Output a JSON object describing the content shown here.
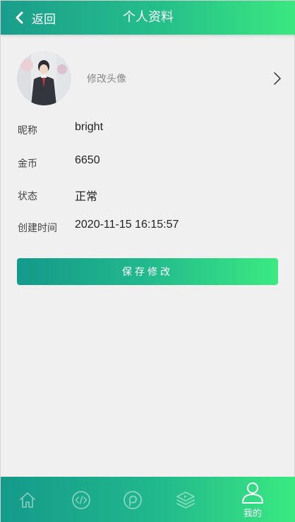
{
  "header": {
    "back_label": "返回",
    "title": "个人资料"
  },
  "avatar": {
    "label": "修改头像"
  },
  "profile": {
    "nickname": {
      "label": "昵称",
      "value": "bright"
    },
    "coins": {
      "label": "金币",
      "value": "6650"
    },
    "status": {
      "label": "状态",
      "value": "正常"
    },
    "created": {
      "label": "创建时间",
      "value": "2020-11-15 16:15:57"
    }
  },
  "save_button": {
    "label": "保存修改"
  },
  "bottom_nav": {
    "items": [
      {
        "icon": "home-icon",
        "active": false
      },
      {
        "icon": "code-icon",
        "active": false
      },
      {
        "icon": "discover-icon",
        "active": false
      },
      {
        "icon": "layers-icon",
        "active": false
      },
      {
        "icon": "user-icon",
        "label": "我的",
        "active": true
      }
    ]
  },
  "colors": {
    "gradient_start": "#149a8a",
    "gradient_end": "#3aea80",
    "background": "#f0f0f0"
  }
}
